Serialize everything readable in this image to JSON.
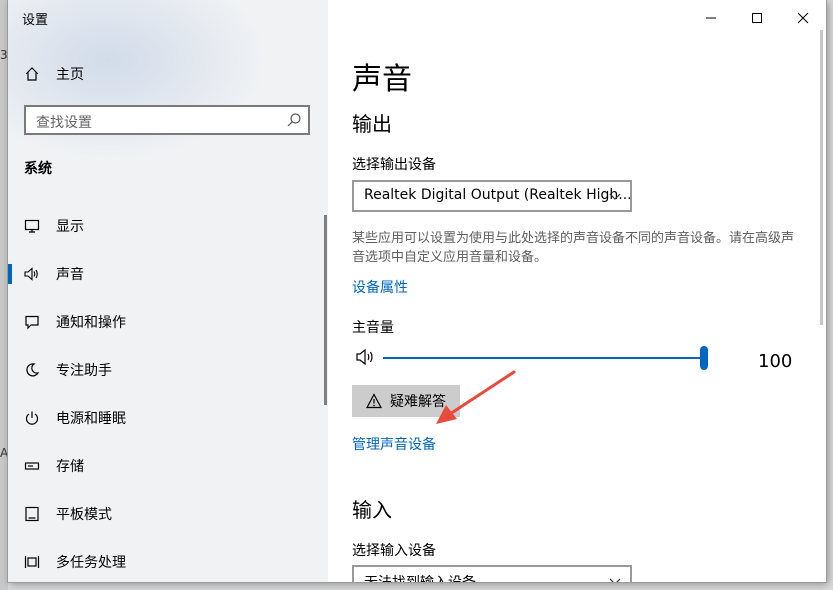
{
  "window": {
    "title": "设置"
  },
  "sidebar": {
    "home_label": "主页",
    "search_placeholder": "查找设置",
    "section_label": "系统",
    "items": [
      {
        "label": "显示",
        "icon": "monitor-icon"
      },
      {
        "label": "声音",
        "icon": "speaker-icon",
        "active": true
      },
      {
        "label": "通知和操作",
        "icon": "notification-icon"
      },
      {
        "label": "专注助手",
        "icon": "moon-icon"
      },
      {
        "label": "电源和睡眠",
        "icon": "power-icon"
      },
      {
        "label": "存储",
        "icon": "storage-icon"
      },
      {
        "label": "平板模式",
        "icon": "tablet-icon"
      },
      {
        "label": "多任务处理",
        "icon": "multitask-icon"
      }
    ]
  },
  "main": {
    "page_title": "声音",
    "output": {
      "heading": "输出",
      "device_label": "选择输出设备",
      "device_value": "Realtek Digital Output (Realtek High...",
      "description": "某些应用可以设置为使用与此处选择的声音设备不同的声音设备。请在高级声音选项中自定义应用音量和设备。",
      "properties_link": "设备属性",
      "volume_label": "主音量",
      "volume_value": "100",
      "troubleshoot_label": "疑难解答",
      "manage_link": "管理声音设备"
    },
    "input": {
      "heading": "输入",
      "device_label": "选择输入设备",
      "device_value": "无法找到输入设备"
    }
  },
  "colors": {
    "accent": "#0067c0",
    "annotation_arrow": "#e84a3c"
  }
}
